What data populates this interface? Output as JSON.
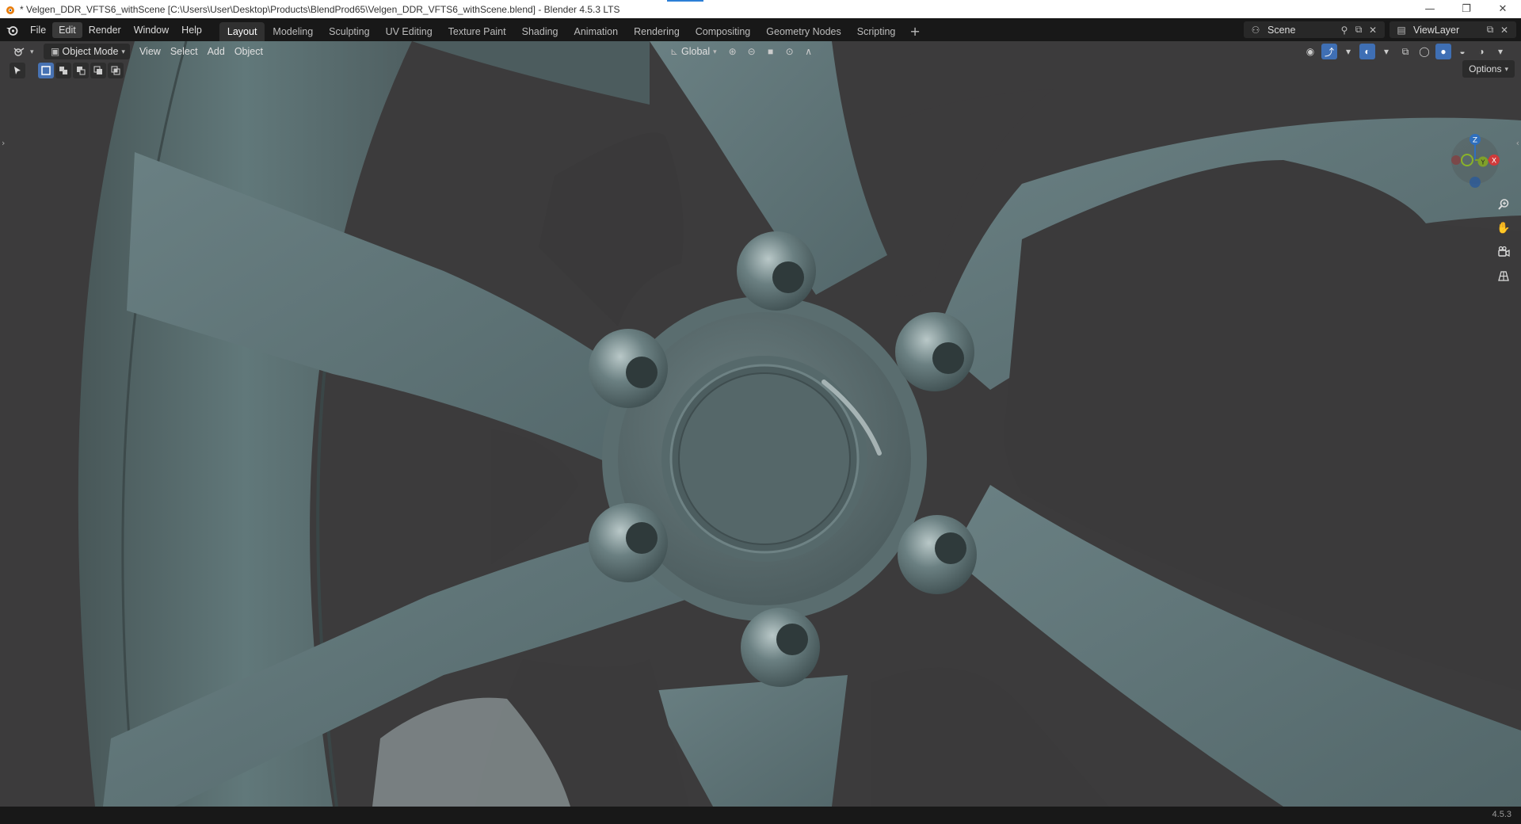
{
  "window": {
    "title": "* Velgen_DDR_VFTS6_withScene [C:\\Users\\User\\Desktop\\Products\\BlendProd65\\Velgen_DDR_VFTS6_withScene.blend] - Blender 4.5.3 LTS",
    "minimize": "—",
    "restore": "❐",
    "close": "✕"
  },
  "menu": [
    "File",
    "Edit",
    "Render",
    "Window",
    "Help"
  ],
  "workspaces": [
    "Layout",
    "Modeling",
    "Sculpting",
    "UV Editing",
    "Texture Paint",
    "Shading",
    "Animation",
    "Rendering",
    "Compositing",
    "Geometry Nodes",
    "Scripting"
  ],
  "workspace_add": "+",
  "scene": {
    "name": "Scene",
    "view_layer": "ViewLayer"
  },
  "viewport_header": {
    "mode": "Object Mode",
    "menus": [
      "View",
      "Select",
      "Add",
      "Object"
    ],
    "orientation": "Global",
    "options": "Options"
  },
  "gizmo": {
    "z": "Z",
    "y": "Y",
    "x": "X"
  },
  "icons": {
    "blender": "blender-logo-icon",
    "editor_type": "3d-viewport-icon",
    "select": "select-box-icon",
    "zoom": "zoom-icon",
    "pan": "hand-pan-icon",
    "camera": "camera-view-icon",
    "ortho": "orthographic-grid-icon"
  },
  "colors": {
    "viewport_bg": "#3c3b3c",
    "wheel": "#5d6e70",
    "active_blue": "#4772b3"
  },
  "status": {
    "version": "4.5.3"
  }
}
